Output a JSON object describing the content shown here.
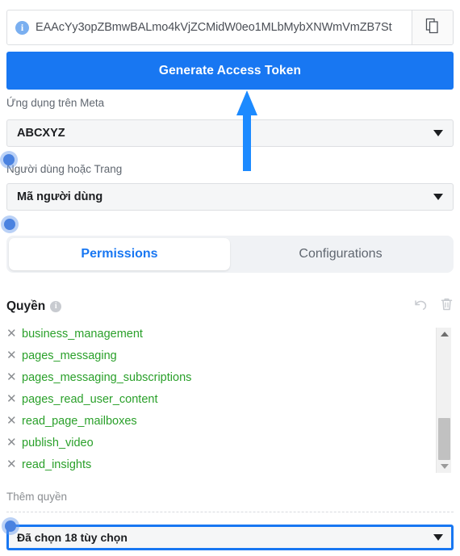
{
  "token_field": {
    "icon": "info-circle-icon",
    "value": "EAAcYy3opZBmwBALmo4kVjZCMidW0eo1MLbMybXNWmVmZB7St",
    "copy_icon": "copy-pages-icon"
  },
  "generate_button": {
    "label": "Generate Access Token",
    "color": "#1877f2"
  },
  "app_field": {
    "label": "Ứng dụng trên Meta",
    "value": "ABCXYZ",
    "caret_icon": "chevron-down-icon"
  },
  "user_field": {
    "label": "Người dùng hoặc Trang",
    "value": "Mã người dùng",
    "caret_icon": "chevron-down-icon"
  },
  "tabs": [
    {
      "label": "Permissions",
      "active": true
    },
    {
      "label": "Configurations",
      "active": false
    }
  ],
  "permissions_header": {
    "title": "Quyền",
    "info_icon": "info-circle-icon",
    "undo_icon": "undo-arrow-icon",
    "delete_icon": "trash-can-icon"
  },
  "permissions": [
    {
      "remove_icon": "close-x-icon",
      "name": "business_management"
    },
    {
      "remove_icon": "close-x-icon",
      "name": "pages_messaging"
    },
    {
      "remove_icon": "close-x-icon",
      "name": "pages_messaging_subscriptions"
    },
    {
      "remove_icon": "close-x-icon",
      "name": "pages_read_user_content"
    },
    {
      "remove_icon": "close-x-icon",
      "name": "read_page_mailboxes"
    },
    {
      "remove_icon": "close-x-icon",
      "name": "publish_video"
    },
    {
      "remove_icon": "close-x-icon",
      "name": "read_insights"
    }
  ],
  "permission_color": "#2aa02a",
  "scrollbar": {
    "up_icon": "triangle-up-icon",
    "down_icon": "triangle-down-icon",
    "thumb": "scrollbar-thumb"
  },
  "add_permission": {
    "label": "Thêm quyền",
    "selected_text": "Đã chọn 18 tùy chọn",
    "caret_icon": "chevron-down-icon",
    "highlight_color": "#1877f2"
  },
  "annotations": {
    "arrow_color": "#1c8aff",
    "dot_color": "#4a82e0"
  }
}
